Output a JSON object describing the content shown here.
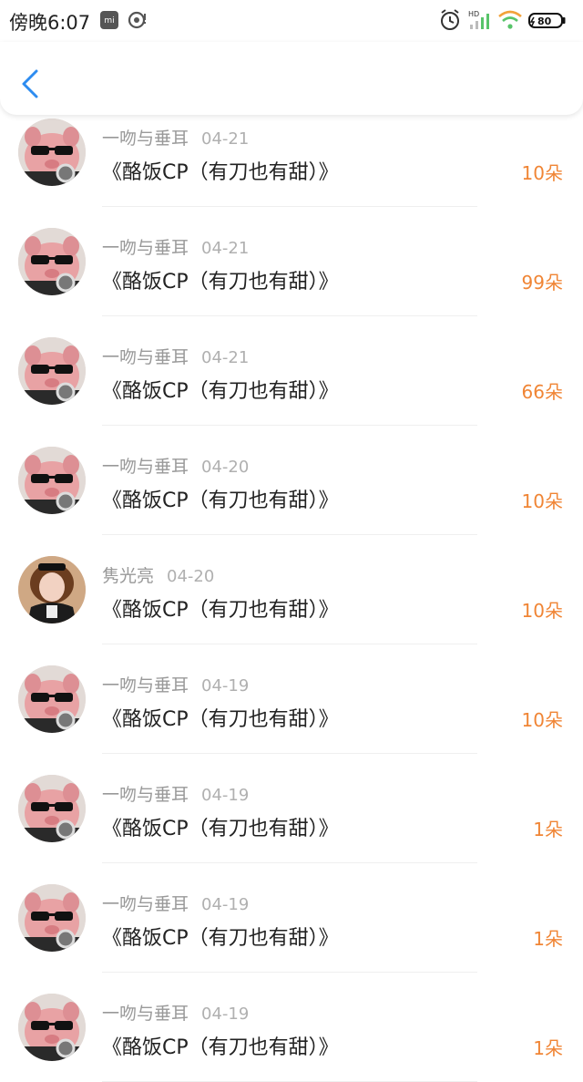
{
  "status_bar": {
    "time": "傍晚6:07",
    "network_label": "HD",
    "battery": "80"
  },
  "colors": {
    "amount": "#f08535",
    "back_arrow": "#2d8cf0"
  },
  "list": {
    "items": [
      {
        "user": "一吻与垂耳",
        "date": "04-21",
        "title": "《酪饭CP（有刀也有甜）》",
        "amount": "10朵",
        "avatar": "pink-pig-sunglasses"
      },
      {
        "user": "一吻与垂耳",
        "date": "04-21",
        "title": "《酪饭CP（有刀也有甜）》",
        "amount": "99朵",
        "avatar": "pink-pig-sunglasses"
      },
      {
        "user": "一吻与垂耳",
        "date": "04-21",
        "title": "《酪饭CP（有刀也有甜）》",
        "amount": "66朵",
        "avatar": "pink-pig-sunglasses"
      },
      {
        "user": "一吻与垂耳",
        "date": "04-20",
        "title": "《酪饭CP（有刀也有甜）》",
        "amount": "10朵",
        "avatar": "pink-pig-sunglasses"
      },
      {
        "user": "隽光亮",
        "date": "04-20",
        "title": "《酪饭CP（有刀也有甜）》",
        "amount": "10朵",
        "avatar": "girl-photo"
      },
      {
        "user": "一吻与垂耳",
        "date": "04-19",
        "title": "《酪饭CP（有刀也有甜）》",
        "amount": "10朵",
        "avatar": "pink-pig-sunglasses"
      },
      {
        "user": "一吻与垂耳",
        "date": "04-19",
        "title": "《酪饭CP（有刀也有甜）》",
        "amount": "1朵",
        "avatar": "pink-pig-sunglasses"
      },
      {
        "user": "一吻与垂耳",
        "date": "04-19",
        "title": "《酪饭CP（有刀也有甜）》",
        "amount": "1朵",
        "avatar": "pink-pig-sunglasses"
      },
      {
        "user": "一吻与垂耳",
        "date": "04-19",
        "title": "《酪饭CP（有刀也有甜）》",
        "amount": "1朵",
        "avatar": "pink-pig-sunglasses"
      }
    ]
  }
}
